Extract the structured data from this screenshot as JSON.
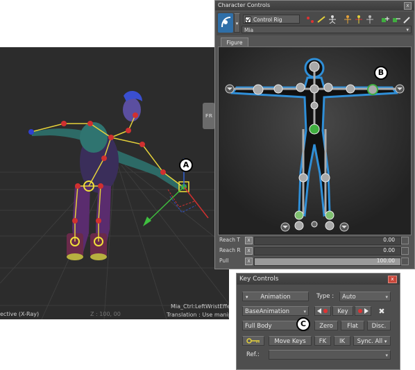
{
  "viewport": {
    "fr_tab": "FR",
    "camera_label": "ective (X-Ray)",
    "grid_label": "Z : 100, 00",
    "effector_label": "Mia_Ctrl:LeftWristEffector",
    "status_label": "Translation : Use manipulator"
  },
  "character_controls": {
    "title": "Character Controls",
    "control_rig_label": "Control Rig",
    "control_rig_checked": true,
    "character_name": "Mia",
    "tab_figure": "Figure",
    "sliders": [
      {
        "label": "Reach T",
        "key": "X",
        "value": "0.00"
      },
      {
        "label": "Reach R",
        "key": "X",
        "value": "0.00"
      },
      {
        "label": "Pull",
        "key": "X",
        "value": "100.00"
      }
    ],
    "toolbar_icons": [
      "select-effector-icon",
      "pin-icon",
      "stance-icon",
      "body-part-icon",
      "mirror-icon",
      "reset-icon",
      "add-icon",
      "tool-icon"
    ],
    "colors": {
      "body_glow": "#2f8fd8",
      "effector_pinned": "#3fae3f",
      "accent": "#3a8fd8"
    }
  },
  "key_controls": {
    "title": "Key Controls",
    "animation_button": "Animation",
    "type_label": "Type :",
    "type_value": "Auto",
    "layer_value": "BaseAnimation",
    "key_button": "Key",
    "delete_icon": "✖",
    "full_body_value": "Full Body",
    "zero_button": "Zero",
    "flat_button": "Flat",
    "disc_button": "Disc.",
    "move_keys_button": "Move Keys",
    "fk_button": "FK",
    "ik_button": "IK",
    "sync_all_button": "Sync. All",
    "ref_label": "Ref.:",
    "ref_value": ""
  },
  "markers": {
    "a": "A",
    "b": "B",
    "c": "C"
  }
}
